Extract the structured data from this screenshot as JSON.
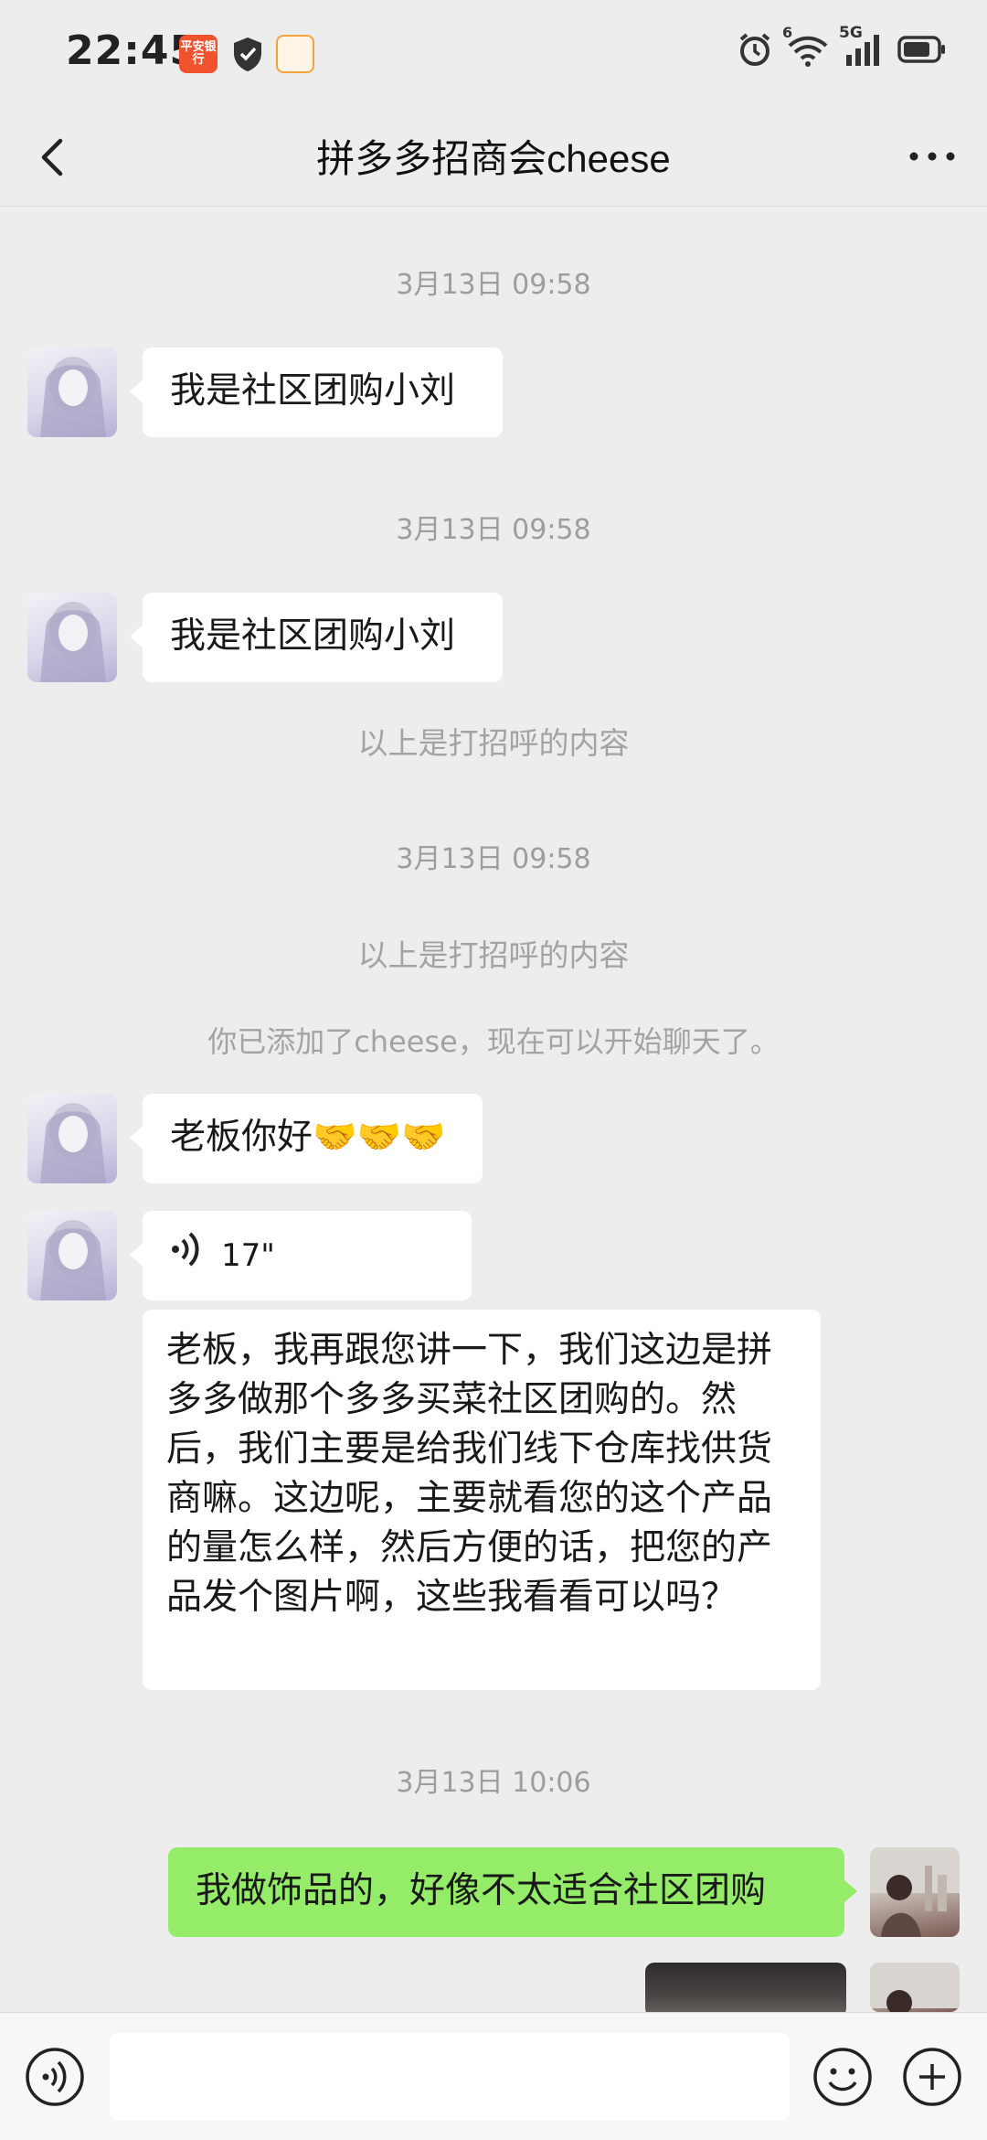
{
  "status_bar": {
    "time": "22:45",
    "bank_app_label": "平安银行",
    "network": "5G",
    "wifi_badge": "6"
  },
  "header": {
    "title": "拼多多招商会cheese"
  },
  "messages": {
    "ts1": "3月13日 09:58",
    "msg1": "我是社区团购小刘",
    "ts2": "3月13日 09:58",
    "msg2": "我是社区团购小刘",
    "sys1": "以上是打招呼的内容",
    "ts3": "3月13日 09:58",
    "sys2": "以上是打招呼的内容",
    "sys3": "你已添加了cheese，现在可以开始聊天了。",
    "msg3": "老板你好🤝🤝🤝",
    "voice_duration": "17\"",
    "voice_transcript": "老板，我再跟您讲一下，我们这边是拼多多做那个多多买菜社区团购的。然后，我们主要是给我们线下仓库找供货商嘛。这边呢，主要就看您的这个产品的量怎么样，然后方便的话，把您的产品发个图片啊，这些我看看可以吗？",
    "ts4": "3月13日 10:06",
    "msg4": "我做饰品的，好像不太适合社区团购"
  },
  "input_bar": {
    "value": ""
  },
  "colors": {
    "chat_background": "#ededed",
    "outgoing_bubble": "#95ec69",
    "incoming_bubble": "#ffffff",
    "timestamp_text": "#9d9d9d"
  },
  "icons": {
    "back": "chevron-left-icon",
    "more": "more-dots-icon",
    "voice": "voice-icon",
    "emoji": "emoji-icon",
    "plus": "plus-icon"
  }
}
